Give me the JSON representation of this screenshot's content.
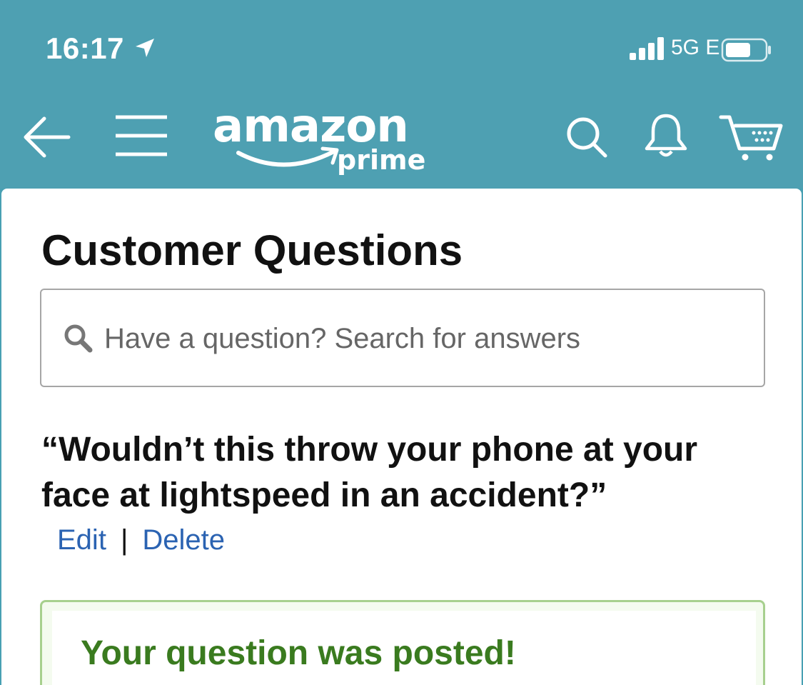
{
  "status_bar": {
    "time": "16:17",
    "network": "5G E"
  },
  "nav": {
    "logo_word": "amazon",
    "logo_sub": "prime"
  },
  "page": {
    "title": "Customer Questions",
    "search_placeholder": "Have a question? Search for answers",
    "question": "“Wouldn’t this throw your phone at your face at lightspeed in an accident?”",
    "edit_label": "Edit",
    "separator": "|",
    "delete_label": "Delete",
    "posted_message": "Your question was posted!"
  },
  "colors": {
    "header_bg": "#4ea0b2",
    "link": "#2b63b2",
    "success_text": "#3a7b1f",
    "success_border": "#a7d08e"
  }
}
